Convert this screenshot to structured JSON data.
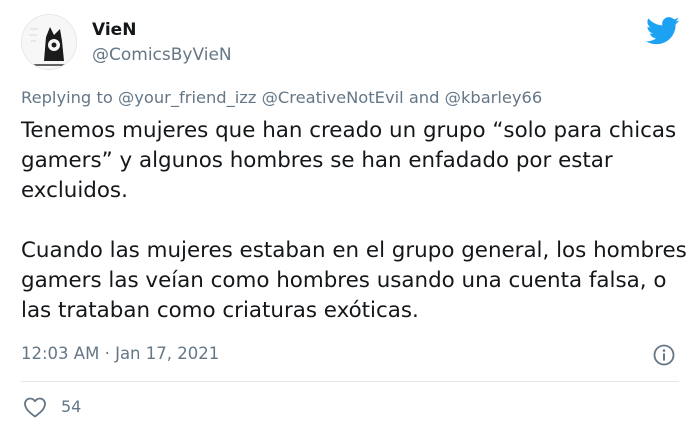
{
  "author": {
    "display_name": "VieN",
    "handle": "@ComicsByVieN"
  },
  "reply": {
    "prefix": "Replying to",
    "mentions": [
      "@your_friend_izz",
      "@CreativeNotEvil",
      "@kbarley66"
    ],
    "conjunction": "and"
  },
  "tweet": {
    "paragraphs": [
      "Tenemos mujeres que han creado un grupo “solo para chicas gamers” y algunos hombres se han enfadado por estar excluidos.",
      "Cuando las mujeres estaban en el grupo general, los hombres gamers las veían como hombres usando una cuenta falsa, o las trataban como criaturas exóticas."
    ],
    "time": "12:03 AM",
    "separator": "·",
    "date": "Jan 17, 2021"
  },
  "engagement": {
    "likes": "54"
  },
  "icons": {
    "brand": "twitter-bird-icon",
    "info": "info-icon",
    "like": "heart-icon"
  },
  "colors": {
    "brand": "#1da1f2",
    "secondary_text": "#657786",
    "primary_text": "#14171a"
  }
}
